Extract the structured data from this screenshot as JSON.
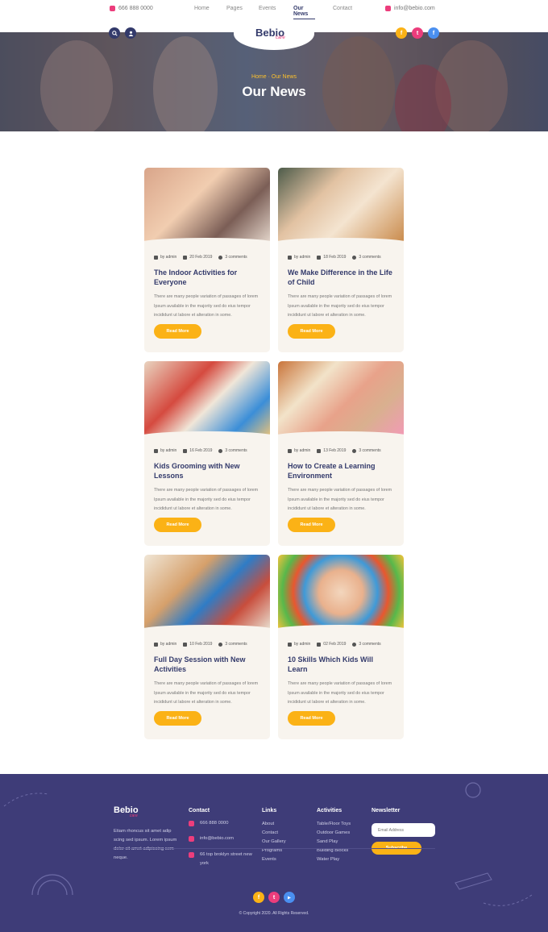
{
  "topbar": {
    "phone": "666 888 0000",
    "email": "info@bebio.com",
    "nav": [
      "Home",
      "Pages",
      "Events",
      "Our News",
      "Contact"
    ],
    "active_nav": "Our News"
  },
  "brand": {
    "logo": "Bebio",
    "logo_sub": "care"
  },
  "hero": {
    "breadcrumb_home": "Home",
    "breadcrumb_sep": "·",
    "breadcrumb_current": "Our News",
    "title": "Our News"
  },
  "header_icons": {
    "search": "search-icon",
    "user": "user-icon",
    "facebook": "f",
    "twitter": "t",
    "facebook2": "f"
  },
  "posts": [
    {
      "author": "by admin",
      "date": "20 Feb 2019",
      "comments": "3 comments",
      "title": "The Indoor Activities for Everyone",
      "excerpt": "There are many people variation of passages of lorem Ipsum available in the majority sed do eius tempor incididunt ut labore et alteration in some.",
      "button": "Read More"
    },
    {
      "author": "by admin",
      "date": "18 Feb 2019",
      "comments": "3 comments",
      "title": "We Make Difference in the Life of Child",
      "excerpt": "There are many people variation of passages of lorem Ipsum available in the majority sed do eius tempor incididunt ut labore et alteration in some.",
      "button": "Read More"
    },
    {
      "author": "by admin",
      "date": "16 Feb 2019",
      "comments": "3 comments",
      "title": "Kids Grooming with New Lessons",
      "excerpt": "There are many people variation of passages of lorem Ipsum available in the majority sed do eius tempor incididunt ut labore et alteration in some.",
      "button": "Read More"
    },
    {
      "author": "by admin",
      "date": "13 Feb 2019",
      "comments": "3 comments",
      "title": "How to Create a Learning Environment",
      "excerpt": "There are many people variation of passages of lorem Ipsum available in the majority sed do eius tempor incididunt ut labore et alteration in some.",
      "button": "Read More"
    },
    {
      "author": "by admin",
      "date": "10 Feb 2019",
      "comments": "3 comments",
      "title": "Full Day Session with New Activities",
      "excerpt": "There are many people variation of passages of lorem Ipsum available in the majority sed do eius tempor incididunt ut labore et alteration in some.",
      "button": "Read More"
    },
    {
      "author": "by admin",
      "date": "02 Feb 2019",
      "comments": "3 comments",
      "title": "10 Skills Which Kids Will Learn",
      "excerpt": "There are many people variation of passages of lorem Ipsum available in the majority sed do eius tempor incididunt ut labore et alteration in some.",
      "button": "Read More"
    }
  ],
  "footer": {
    "logo": "Bebio",
    "logo_sub": "care",
    "about": "Etiam rhoncus sit amet adip scing sed ipsum. Lorem ipsum dolor sit amet adipiscing sem neque.",
    "contact_title": "Contact",
    "contact_phone": "666 888 0000",
    "contact_email": "info@bebio.com",
    "contact_address": "66 top broklyn street new york",
    "links_title": "Links",
    "links": [
      "About",
      "Contact",
      "Our Gallery",
      "Programs",
      "Events"
    ],
    "activities_title": "Activities",
    "activities": [
      "Table/Floor Toys",
      "Outdoor Games",
      "Sand Play",
      "Building Blocks",
      "Water Play"
    ],
    "newsletter_title": "Newsletter",
    "email_placeholder": "Email Address",
    "subscribe": "Subscribe",
    "copyright": "© Copyright 2020. All Rights Reserved."
  },
  "colors": {
    "primary": "#333a6b",
    "accent_yellow": "#fbb216",
    "accent_pink": "#ec3d7c",
    "accent_blue": "#4a8ff0",
    "footer_bg": "#3e3c78",
    "card_bg": "#f8f4ee"
  }
}
